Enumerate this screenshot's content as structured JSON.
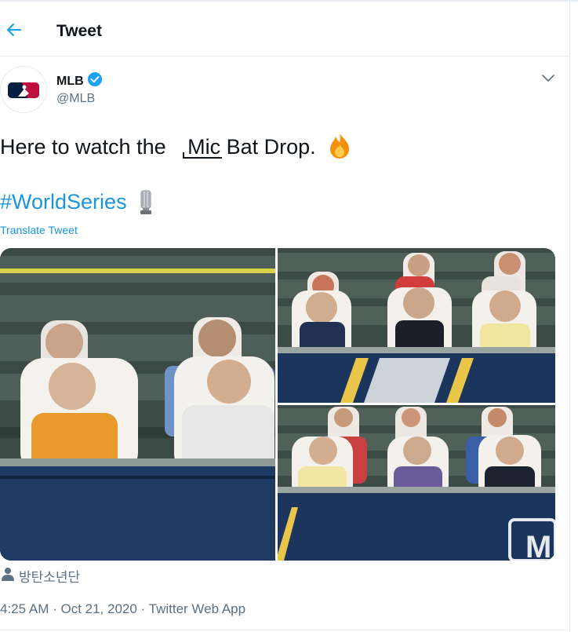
{
  "header": {
    "title": "Tweet",
    "back_icon": "back-arrow-icon"
  },
  "author": {
    "name": "MLB",
    "handle": "@MLB",
    "verified_icon": "verified-badge-icon",
    "logo": "mlb-logo"
  },
  "tweet": {
    "text_before": "Here to watch the ",
    "text_struck": "Mic",
    "text_after": " Bat Drop.",
    "emoji_fire": "🔥",
    "hashtag": "#WorldSeries",
    "trophy_icon": "trophy-icon",
    "translate_label": "Translate Tweet"
  },
  "media": {
    "photos": [
      {
        "id": "photo-left-large"
      },
      {
        "id": "photo-top-right"
      },
      {
        "id": "photo-bottom-right"
      }
    ],
    "watermark_letter": "M"
  },
  "tagged": {
    "icon": "person-icon",
    "label": "방탄소년단"
  },
  "meta": {
    "line": "4:25 AM · Oct 21, 2020 · Twitter Web App"
  },
  "colors": {
    "link": "#1b95e0",
    "secondary": "#5b7083",
    "mlb_blue": "#041e42",
    "mlb_red": "#bf0d3e"
  }
}
